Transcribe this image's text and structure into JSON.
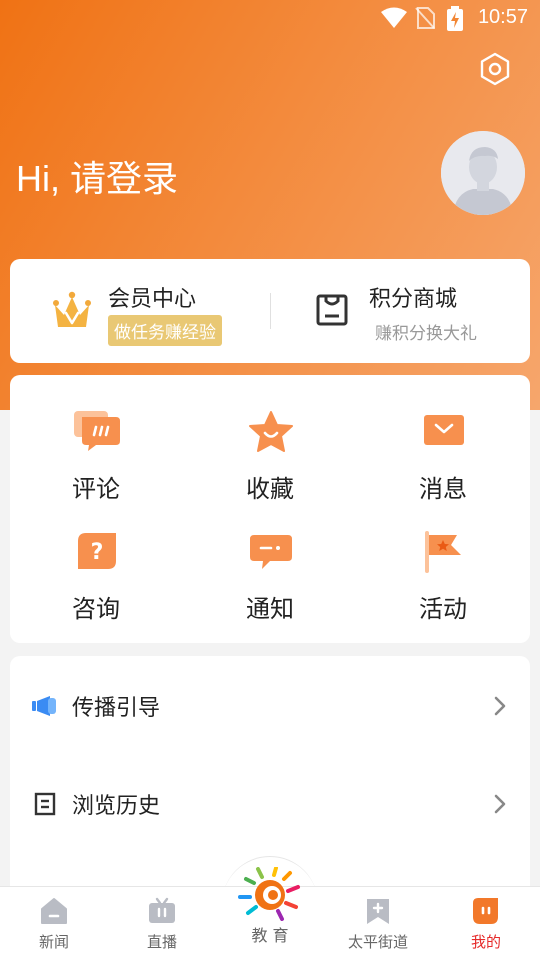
{
  "status_bar": {
    "time": "10:57"
  },
  "header": {
    "greeting": "Hi, 请登录"
  },
  "member_card": {
    "member": {
      "title": "会员中心",
      "badge": "做任务赚经验"
    },
    "points": {
      "title": "积分商城",
      "subtitle": "赚积分换大礼"
    }
  },
  "features": [
    {
      "label": "评论"
    },
    {
      "label": "收藏"
    },
    {
      "label": "消息"
    },
    {
      "label": "咨询"
    },
    {
      "label": "通知"
    },
    {
      "label": "活动"
    }
  ],
  "list": [
    {
      "label": "传播引导"
    },
    {
      "label": "浏览历史"
    }
  ],
  "tabs": [
    {
      "label": "新闻"
    },
    {
      "label": "直播"
    },
    {
      "label": "教 育"
    },
    {
      "label": "太平街道"
    },
    {
      "label": "我的"
    }
  ],
  "colors": {
    "accent": "#f07214",
    "active_tab": "#e62b2b",
    "badge": "#e9c874"
  }
}
